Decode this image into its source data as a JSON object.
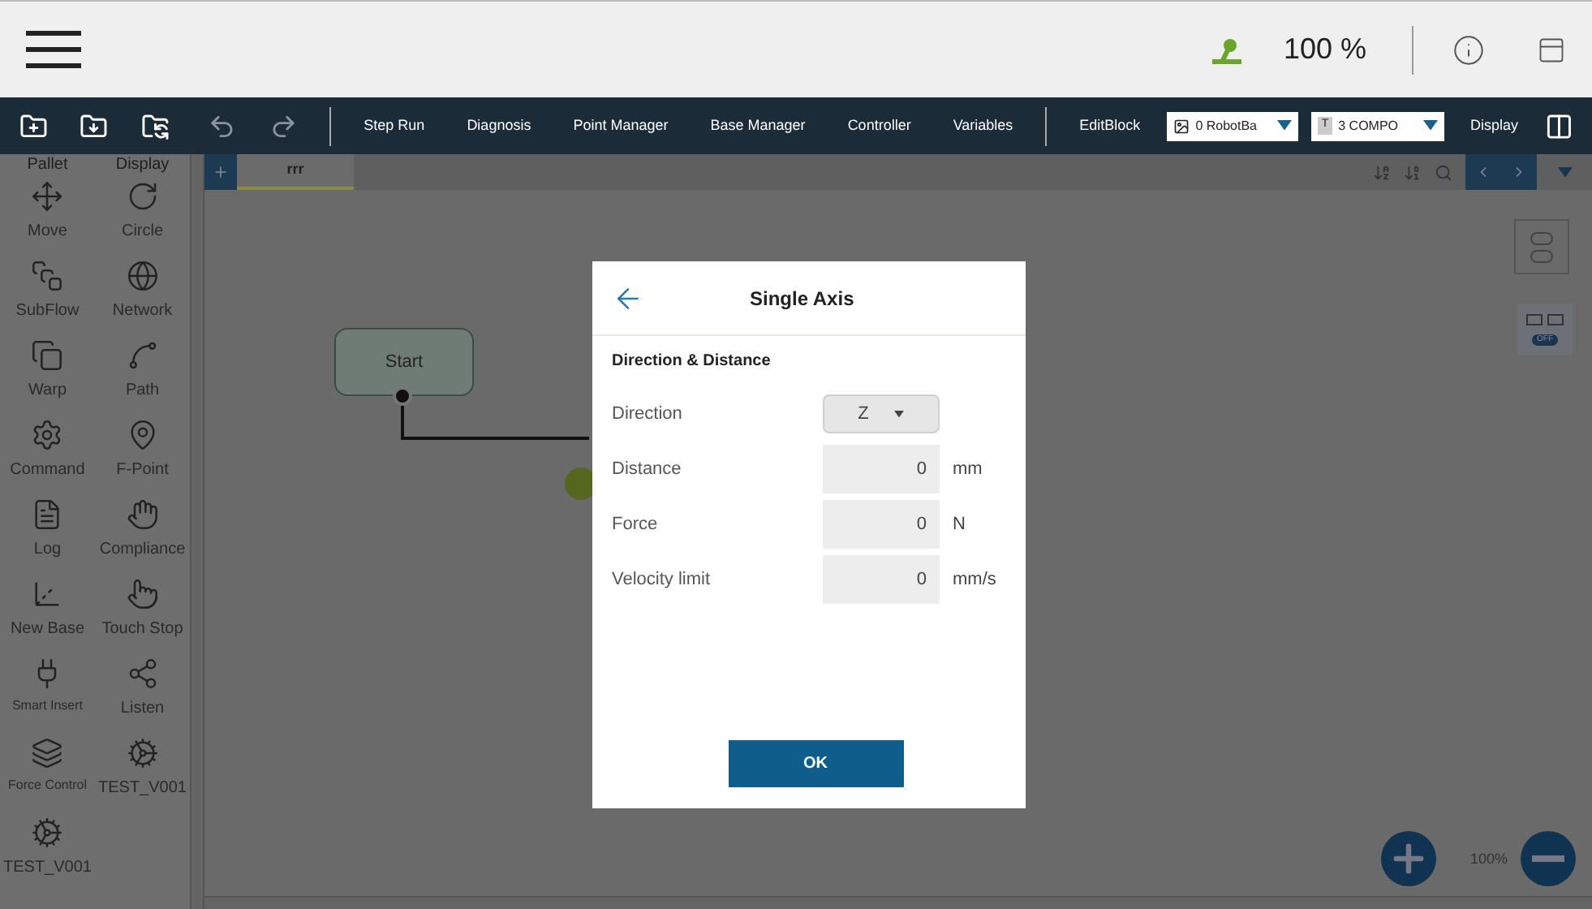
{
  "top_bar": {
    "zoom": "100 %"
  },
  "toolbar": {
    "items": [
      "Step Run",
      "Diagnosis",
      "Point Manager",
      "Base Manager",
      "Controller",
      "Variables"
    ],
    "edit_block": "EditBlock",
    "base_select": "0 RobotBa",
    "tool_select": {
      "badge": "T",
      "label": "3 COMPO"
    },
    "display": "Display"
  },
  "tabs": [
    {
      "label": "rrr",
      "selected": true
    }
  ],
  "palette": {
    "header": [
      "Pallet",
      "Display"
    ],
    "items": [
      {
        "label": "Move",
        "kind": "move"
      },
      {
        "label": "Circle",
        "kind": "circle"
      },
      {
        "label": "SubFlow",
        "kind": "subflow"
      },
      {
        "label": "Network",
        "kind": "network"
      },
      {
        "label": "Warp",
        "kind": "warp"
      },
      {
        "label": "Path",
        "kind": "path"
      },
      {
        "label": "Command",
        "kind": "command"
      },
      {
        "label": "F-Point",
        "kind": "fpoint"
      },
      {
        "label": "Log",
        "kind": "log"
      },
      {
        "label": "Compliance",
        "kind": "compliance"
      },
      {
        "label": "New Base",
        "kind": "newbase"
      },
      {
        "label": "Touch Stop",
        "kind": "touchstop"
      },
      {
        "label": "Smart Insert",
        "kind": "smartinsert"
      },
      {
        "label": "Listen",
        "kind": "listen"
      },
      {
        "label": "Force Control",
        "kind": "forcecontrol"
      },
      {
        "label": "TEST_V001",
        "kind": "custom"
      },
      {
        "label": "TEST_V001",
        "kind": "custom"
      }
    ]
  },
  "canvas": {
    "start_node": "Start",
    "toggle": "OFF",
    "zoom": "100%"
  },
  "dialog": {
    "title": "Single Axis",
    "section": "Direction & Distance",
    "fields": [
      {
        "label": "Direction",
        "kind": "select",
        "value": "Z"
      },
      {
        "label": "Distance",
        "kind": "number",
        "value": "0",
        "unit": "mm"
      },
      {
        "label": "Force",
        "kind": "number",
        "value": "0",
        "unit": "N"
      },
      {
        "label": "Velocity limit",
        "kind": "number",
        "value": "0",
        "unit": "mm/s"
      }
    ],
    "ok": "OK"
  }
}
